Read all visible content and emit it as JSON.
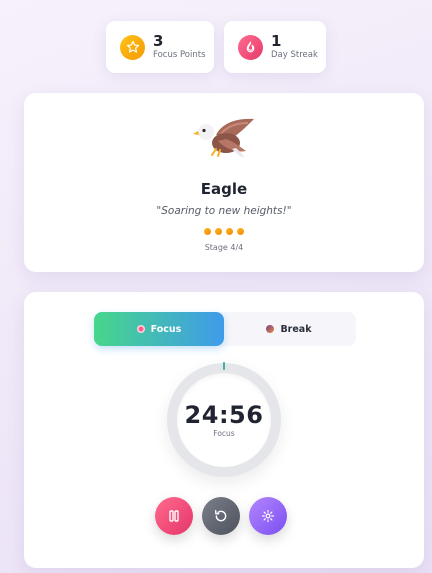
{
  "stats": {
    "points": {
      "value": "3",
      "label": "Focus Points",
      "icon": "star-icon"
    },
    "streak": {
      "value": "1",
      "label": "Day Streak",
      "icon": "fire-icon"
    }
  },
  "pet": {
    "icon": "eagle-icon",
    "name": "Eagle",
    "quote": "\"Soaring to new heights!\"",
    "stage_current": 4,
    "stage_total": 4,
    "stage_label": "Stage 4/4"
  },
  "timer": {
    "modes": [
      {
        "label": "Focus",
        "active": true,
        "icon": "target-icon"
      },
      {
        "label": "Break",
        "active": false,
        "icon": "coffee-icon"
      }
    ],
    "time": "24:56",
    "mode_label": "Focus",
    "controls": {
      "pause": "pause-icon",
      "reset": "reset-icon",
      "settings": "gear-icon"
    }
  },
  "colors": {
    "accent_green": "#47d68a",
    "accent_blue": "#3f9bea",
    "pause": "#e5366a",
    "settings": "#7b4ff0",
    "star": "#f59a00"
  }
}
